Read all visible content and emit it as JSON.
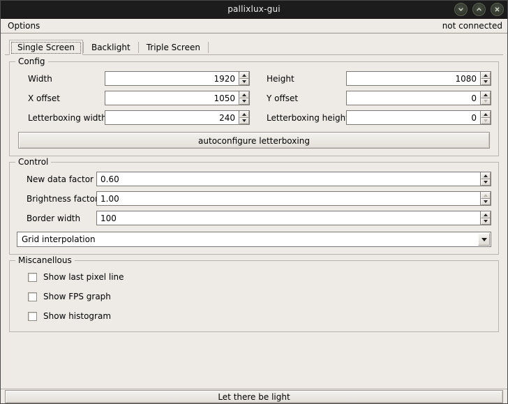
{
  "window": {
    "title": "pallixlux-gui",
    "buttons": [
      {
        "name": "minimize",
        "glyph": "chevron-down"
      },
      {
        "name": "maximize",
        "glyph": "chevron-up"
      },
      {
        "name": "close",
        "glyph": "x"
      }
    ]
  },
  "menubar": {
    "items": [
      {
        "label": "Options"
      }
    ],
    "status": "not connected"
  },
  "tabs": [
    {
      "label": "Single Screen",
      "active": true
    },
    {
      "label": "Backlight",
      "active": false
    },
    {
      "label": "Triple Screen",
      "active": false
    }
  ],
  "config": {
    "title": "Config",
    "fields": [
      {
        "label": "Width",
        "value": "1920",
        "up_enabled": true,
        "down_enabled": true
      },
      {
        "label": "Height",
        "value": "1080",
        "up_enabled": true,
        "down_enabled": true
      },
      {
        "label": "X offset",
        "value": "1050",
        "up_enabled": true,
        "down_enabled": true
      },
      {
        "label": "Y offset",
        "value": "0",
        "up_enabled": true,
        "down_enabled": false
      },
      {
        "label": "Letterboxing width",
        "value": "240",
        "up_enabled": true,
        "down_enabled": true
      },
      {
        "label": "Letterboxing height",
        "value": "0",
        "up_enabled": true,
        "down_enabled": false
      }
    ],
    "autoconfigure_label": "autoconfigure letterboxing"
  },
  "control": {
    "title": "Control",
    "fields": [
      {
        "label": "New data factor",
        "value": "0.60",
        "up_enabled": true,
        "down_enabled": true
      },
      {
        "label": "Brightness factor",
        "value": "1.00",
        "up_enabled": false,
        "down_enabled": true
      },
      {
        "label": "Border width",
        "value": "100",
        "up_enabled": true,
        "down_enabled": true
      }
    ],
    "interpolation": {
      "selected": "Grid interpolation",
      "icon": "chevron-down-icon"
    }
  },
  "misc": {
    "title": "Miscanellous",
    "checkboxes": [
      {
        "label": "Show last pixel line",
        "checked": false
      },
      {
        "label": "Show FPS graph",
        "checked": false
      },
      {
        "label": "Show histogram",
        "checked": false
      }
    ]
  },
  "statusbar": {
    "action_label": "Let there be light"
  }
}
